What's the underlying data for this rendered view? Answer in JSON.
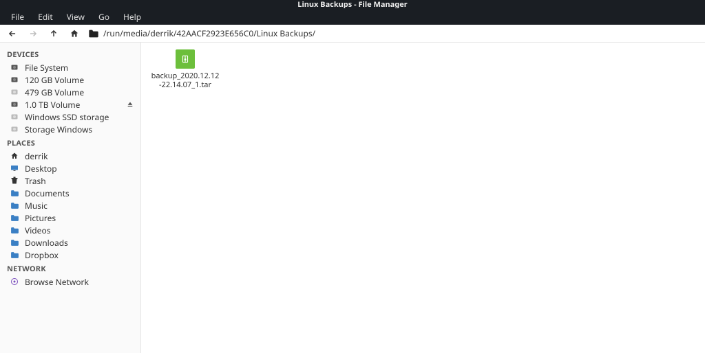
{
  "window": {
    "title": "Linux Backups - File Manager"
  },
  "menubar": {
    "items": [
      "File",
      "Edit",
      "View",
      "Go",
      "Help"
    ]
  },
  "toolbar": {
    "path": "/run/media/derrik/42AACF2923E656C0/Linux Backups/"
  },
  "sidebar": {
    "sections": [
      {
        "heading": "DEVICES",
        "items": [
          {
            "label": "File System",
            "icon": "disk-dark",
            "eject": false
          },
          {
            "label": "120 GB Volume",
            "icon": "disk-dark",
            "eject": false
          },
          {
            "label": "479 GB Volume",
            "icon": "disk-light",
            "eject": false
          },
          {
            "label": "1.0 TB Volume",
            "icon": "disk-dark",
            "eject": true
          },
          {
            "label": "Windows SSD storage",
            "icon": "disk-light",
            "eject": false
          },
          {
            "label": "Storage Windows",
            "icon": "disk-light",
            "eject": false
          }
        ]
      },
      {
        "heading": "PLACES",
        "items": [
          {
            "label": "derrik",
            "icon": "home",
            "eject": false
          },
          {
            "label": "Desktop",
            "icon": "desktop",
            "eject": false
          },
          {
            "label": "Trash",
            "icon": "trash",
            "eject": false
          },
          {
            "label": "Documents",
            "icon": "folder",
            "eject": false
          },
          {
            "label": "Music",
            "icon": "folder",
            "eject": false
          },
          {
            "label": "Pictures",
            "icon": "folder",
            "eject": false
          },
          {
            "label": "Videos",
            "icon": "folder",
            "eject": false
          },
          {
            "label": "Downloads",
            "icon": "folder",
            "eject": false
          },
          {
            "label": "Dropbox",
            "icon": "folder",
            "eject": false
          }
        ]
      },
      {
        "heading": "NETWORK",
        "items": [
          {
            "label": "Browse Network",
            "icon": "network",
            "eject": false
          }
        ]
      }
    ]
  },
  "content": {
    "files": [
      {
        "label": "backup_2020.12.12-22.14.07_1.tar",
        "icon": "archive"
      }
    ]
  }
}
